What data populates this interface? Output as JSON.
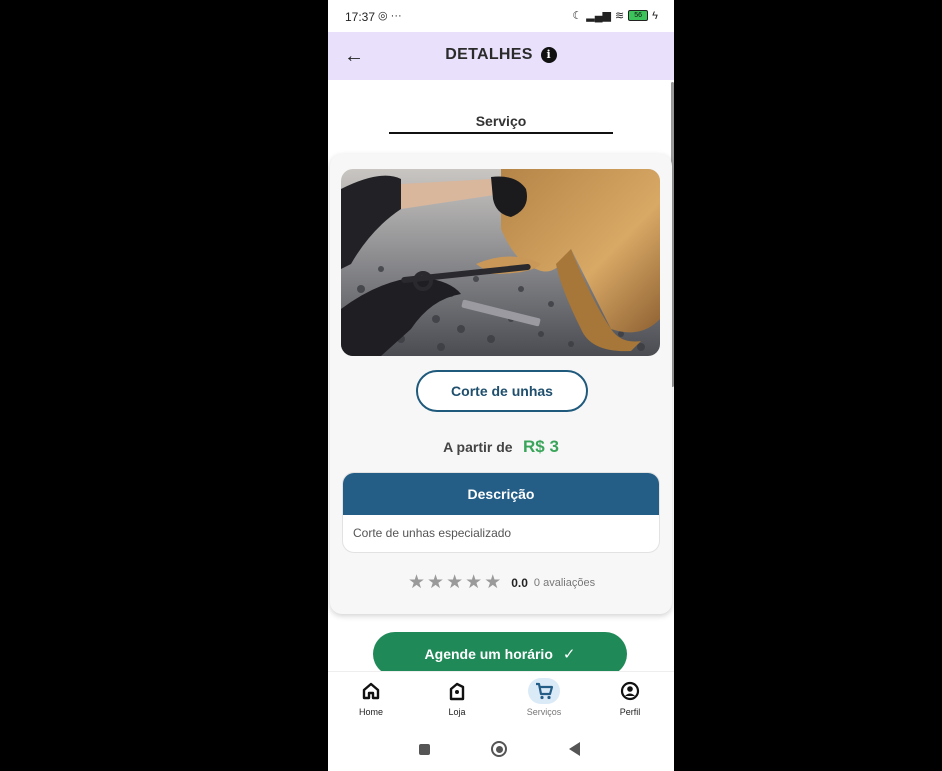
{
  "status_bar": {
    "time": "17:37",
    "left_icons": "◎ ···",
    "battery": "56"
  },
  "header": {
    "title": "DETALHES",
    "info_glyph": "i",
    "back_glyph": "←"
  },
  "tab": {
    "label": "Serviço"
  },
  "service": {
    "name": "Corte de unhas",
    "price_label": "A partir de",
    "price_value": "R$ 3",
    "description_title": "Descrição",
    "description_text": "Corte de unhas especializado",
    "rating_value": "0.0",
    "rating_count": "0 avaliações",
    "stars_filled": 0,
    "stars_total": 5
  },
  "cta": {
    "label": "Agende um horário",
    "icon": "check-icon"
  },
  "bottom_nav": {
    "items": [
      {
        "label": "Home",
        "icon": "home-icon"
      },
      {
        "label": "Loja",
        "icon": "store-icon"
      },
      {
        "label": "Serviços",
        "icon": "cart-icon",
        "active": true
      },
      {
        "label": "Perfil",
        "icon": "profile-icon"
      }
    ]
  },
  "colors": {
    "header_bg": "#e9e0fb",
    "accent_blue": "#245e87",
    "price_green": "#3aa55a",
    "cta_green": "#1f8a58"
  }
}
